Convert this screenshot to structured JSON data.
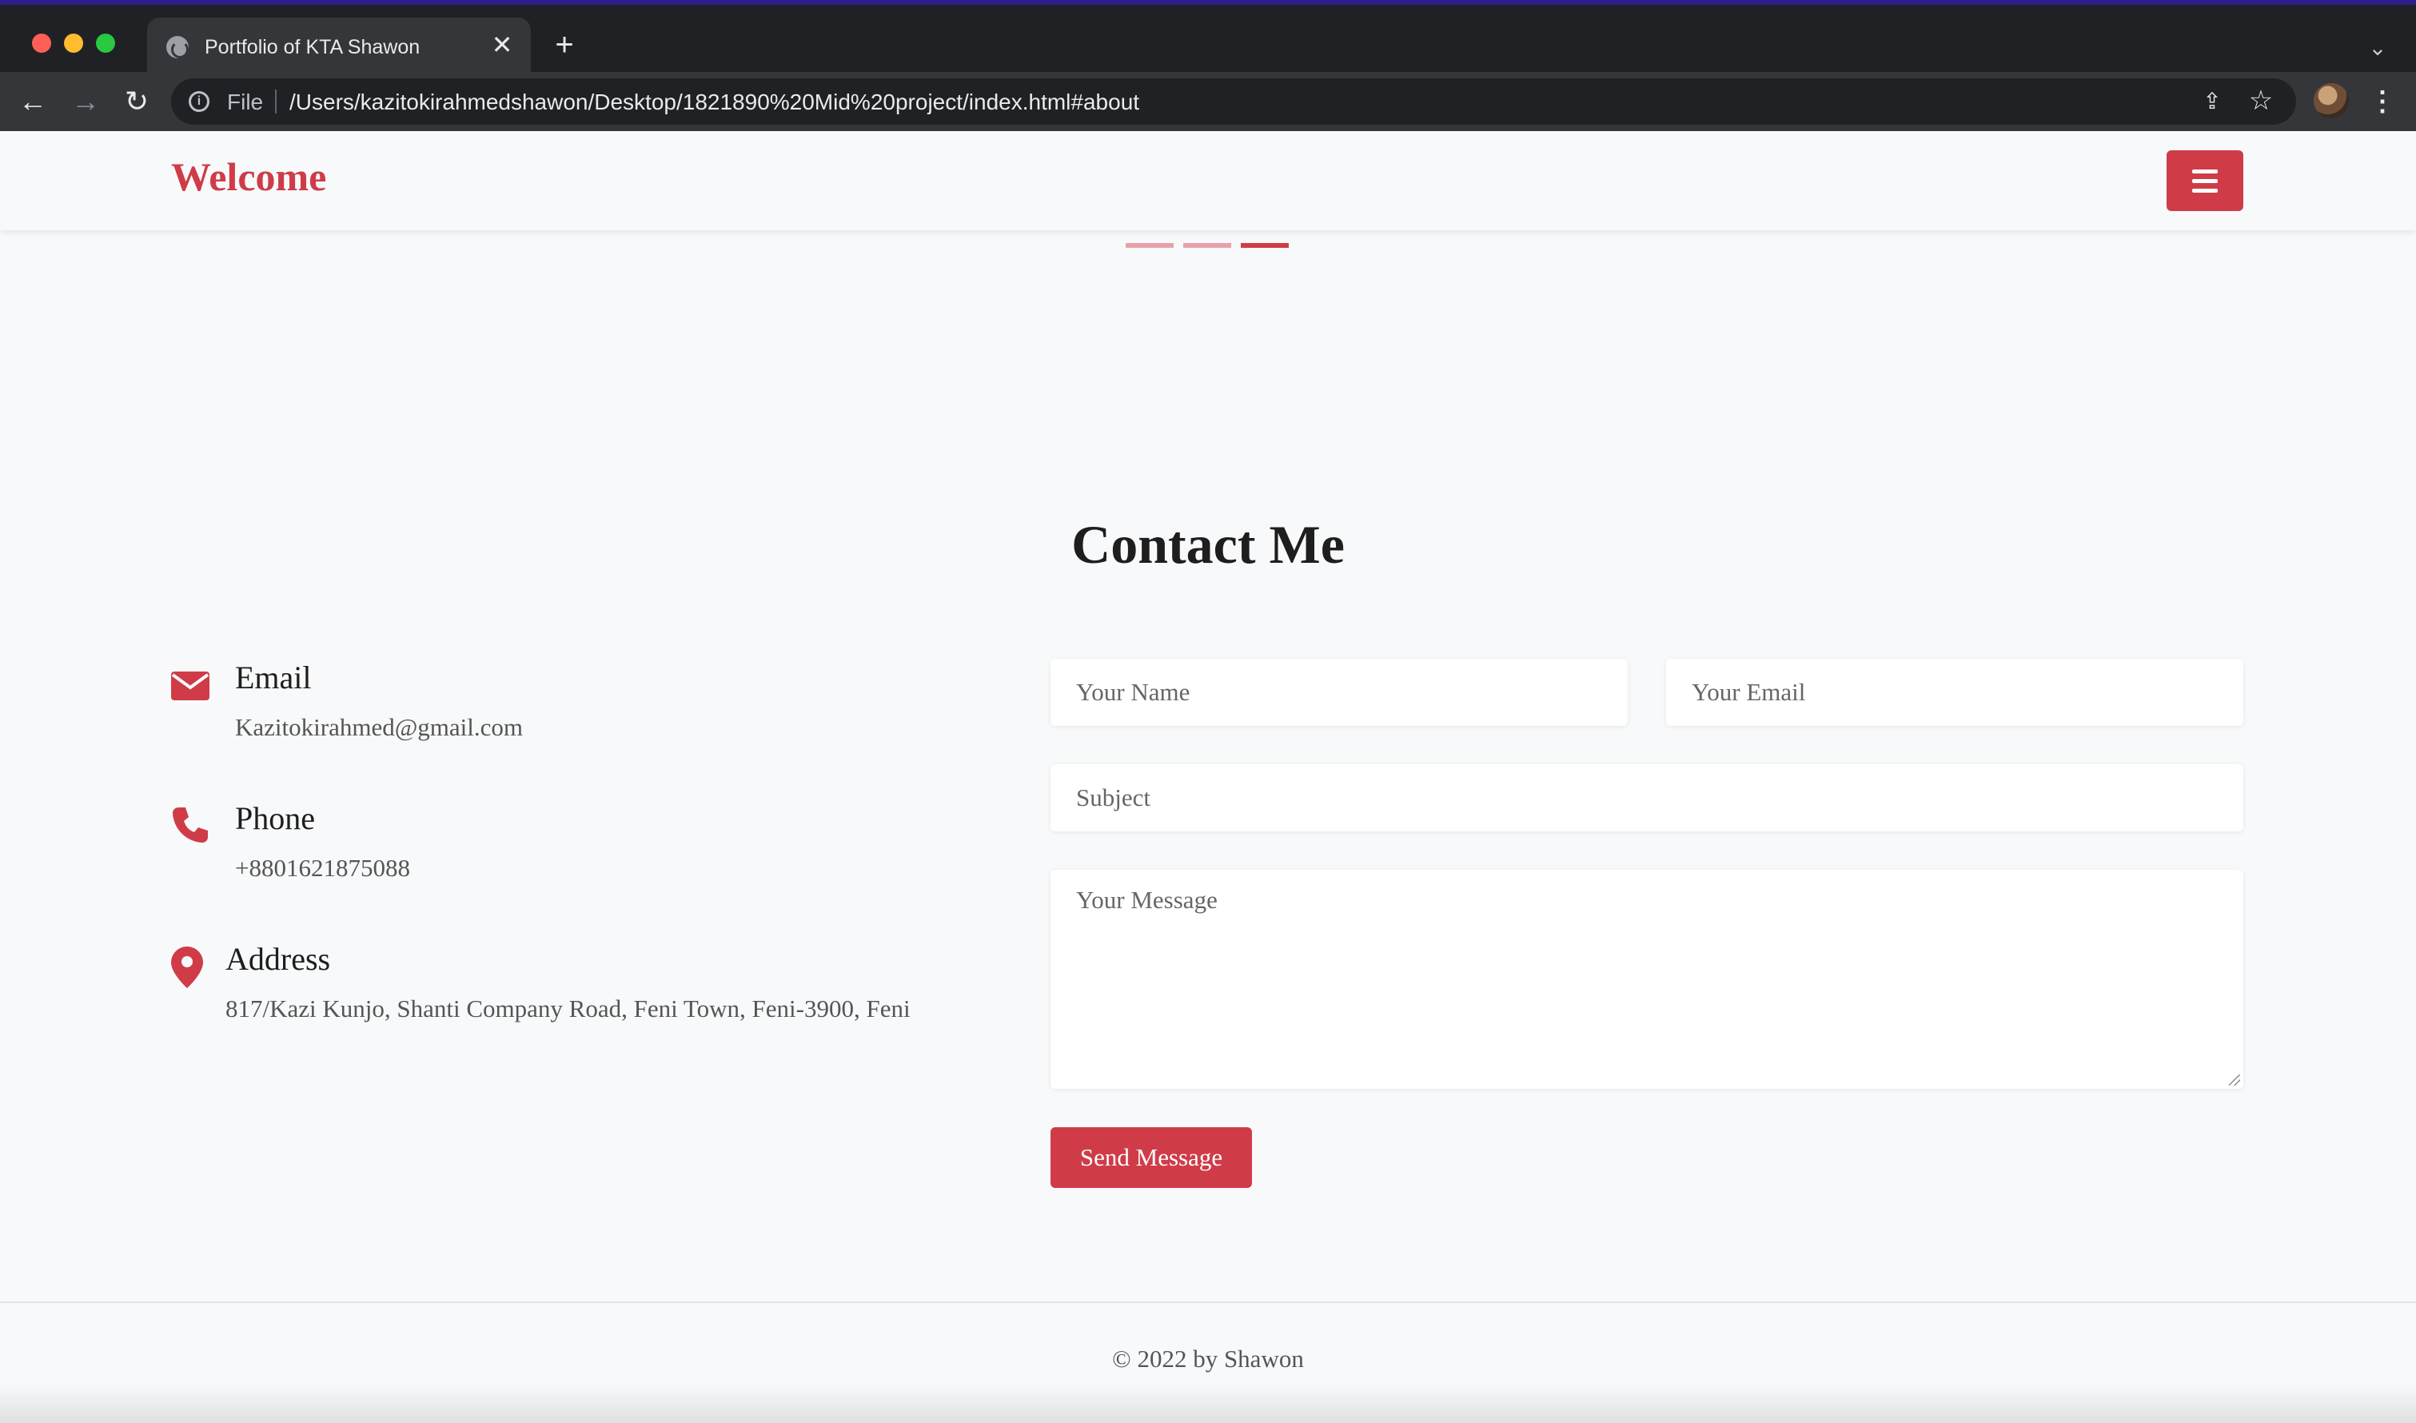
{
  "browser": {
    "tab_title": "Portfolio of KTA Shawon",
    "tab_close": "✕",
    "new_tab": "+",
    "tab_dropdown": "⌄",
    "back": "←",
    "forward": "→",
    "reload": "↻",
    "file_label": "File",
    "url": "/Users/kazitokirahmedshawon/Desktop/1821890%20Mid%20project/index.html#about",
    "share": "⇪",
    "star": "☆",
    "menu": "⋮"
  },
  "navbar": {
    "brand": "Welcome"
  },
  "carousel": {
    "active_indicator": 3,
    "indicator_count": 3
  },
  "contact": {
    "title": "Contact Me",
    "info": [
      {
        "label": "Email",
        "value": "Kazitokirahmed@gmail.com",
        "icon": "envelope-icon"
      },
      {
        "label": "Phone",
        "value": "+8801621875088",
        "icon": "phone-icon"
      },
      {
        "label": "Address",
        "value": "817/Kazi Kunjo, Shanti Company Road, Feni Town, Feni-3900, Feni",
        "icon": "map-marker-icon"
      }
    ],
    "form": {
      "name_placeholder": "Your Name",
      "email_placeholder": "Your Email",
      "subject_placeholder": "Subject",
      "message_placeholder": "Your Message",
      "submit_label": "Send Message"
    }
  },
  "footer": {
    "text": "© 2022 by Shawon"
  },
  "colors": {
    "accent": "#cf3c48",
    "page_bg": "#f8f9fa",
    "chrome_dark": "#202124",
    "chrome_toolbar": "#35363a"
  }
}
